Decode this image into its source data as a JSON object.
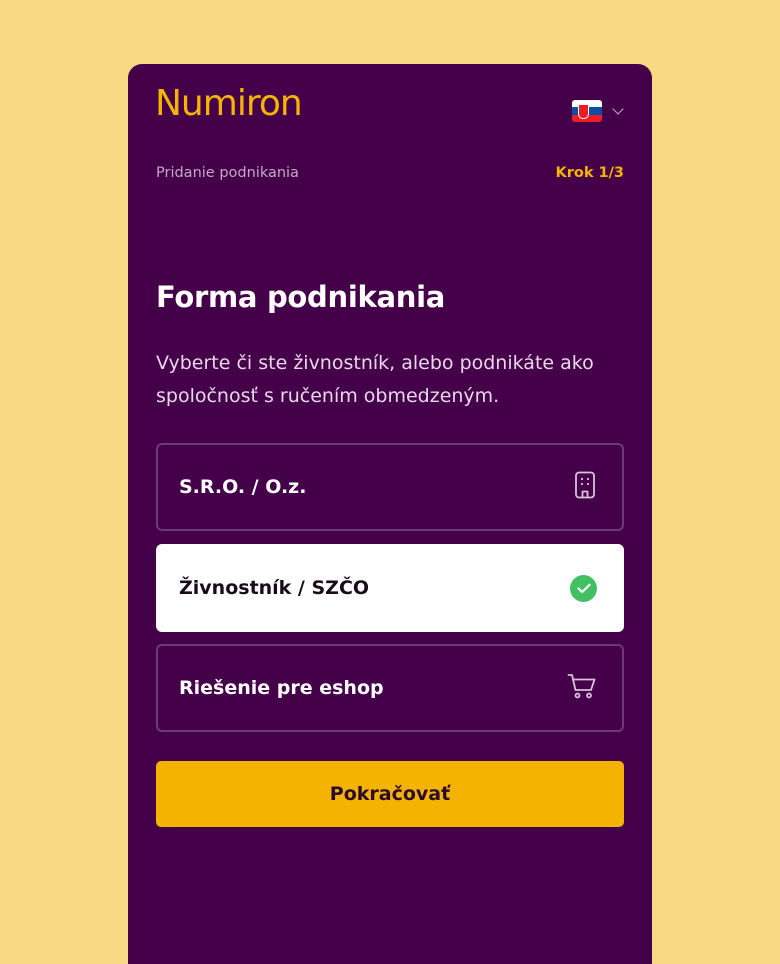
{
  "brand": {
    "name": "Numiron",
    "accent": "#f4b400",
    "panel_bg": "#45004a",
    "page_bg": "#f8d983"
  },
  "language": {
    "icon": "slovak-flag-icon",
    "flag_colors": [
      "#ffffff",
      "#0b4ea2",
      "#ee1c25"
    ],
    "dropdown_icon": "chevron-down-icon"
  },
  "header": {
    "step_title": "Pridanie podnikania",
    "step_count": "Krok 1/3"
  },
  "main": {
    "title": "Forma podnikania",
    "description": "Vyberte či ste živnostník, alebo podnikáte ako spoločnosť s ručením obmedzeným.",
    "options": [
      {
        "label": "S.R.O. / O.z.",
        "icon": "building-icon",
        "selected": false
      },
      {
        "label": "Živnostník / SZČO",
        "icon": "check-circle-icon",
        "selected": true
      },
      {
        "label": "Riešenie pre eshop",
        "icon": "shopping-cart-icon",
        "selected": false
      }
    ],
    "continue_label": "Pokračovať",
    "continue_color": "#f3b300",
    "selected_check_color": "#43c064"
  }
}
